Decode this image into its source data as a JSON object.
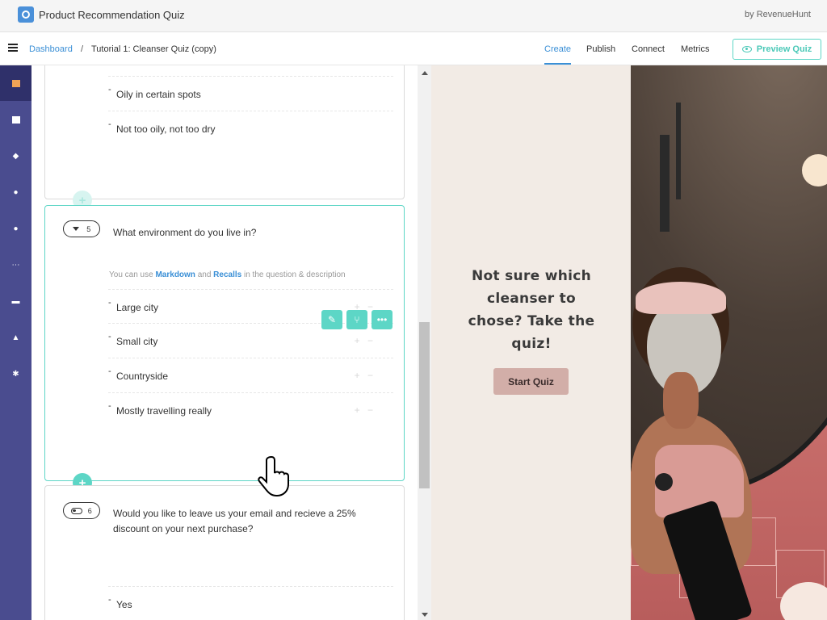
{
  "app": {
    "title": "Product Recommendation Quiz",
    "by": "by RevenueHunt"
  },
  "breadcrumb": {
    "root": "Dashboard",
    "separator": "/",
    "current": "Tutorial 1: Cleanser Quiz (copy)"
  },
  "nav": {
    "tabs": [
      "Create",
      "Publish",
      "Connect",
      "Metrics"
    ],
    "active": "Create",
    "preview_label": "Preview Quiz"
  },
  "sidebar": {
    "items": [
      {
        "icon": "list-icon",
        "active": true
      },
      {
        "icon": "box-icon"
      },
      {
        "icon": "tag-icon"
      },
      {
        "icon": "user-icon"
      },
      {
        "icon": "drop-icon"
      },
      {
        "icon": "flow-icon"
      },
      {
        "icon": "cart-icon"
      },
      {
        "icon": "bell-icon"
      },
      {
        "icon": "gear-icon"
      }
    ]
  },
  "questions": {
    "q4": {
      "options": [
        "Oily in certain spots",
        "Not too oily, not too dry"
      ]
    },
    "q5": {
      "number": "5",
      "text": "What environment do you live in?",
      "hint_prefix": "You can use",
      "hint_markdown": "Markdown",
      "hint_and": "and",
      "hint_recalls": "Recalls",
      "hint_suffix": "in the question & description",
      "options": [
        "Large city",
        "Small city",
        "Countryside",
        "Mostly travelling really"
      ],
      "option_controls": "+ −"
    },
    "q6": {
      "number": "6",
      "text": "Would you like to leave us your email and recieve a 25% discount on your next purchase?",
      "options": [
        "Yes"
      ]
    }
  },
  "preview": {
    "heading": "Not sure which cleanser to chose? Take the quiz!",
    "start_label": "Start Quiz",
    "bg_color": "#f2ebe5",
    "button_color": "#d2aea8"
  },
  "colors": {
    "accent": "#5dd6c6",
    "link": "#3a8fd6",
    "sidebar": "#4a4c8f"
  }
}
